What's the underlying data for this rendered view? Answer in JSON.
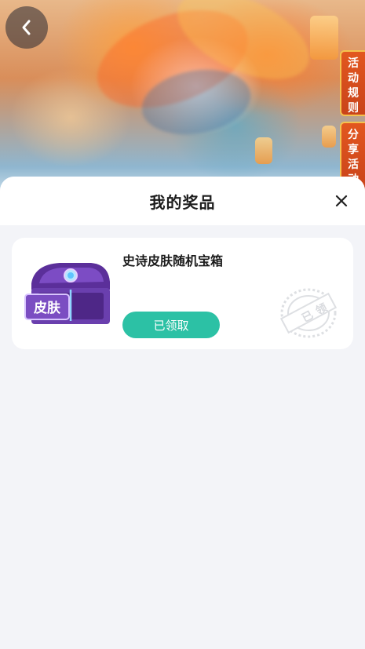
{
  "banner": {
    "tabs": {
      "rules_chars": [
        "活",
        "动",
        "规",
        "则"
      ],
      "share_chars": [
        "分",
        "享",
        "活",
        "动"
      ]
    }
  },
  "sheet": {
    "title": "我的奖品"
  },
  "prizes": [
    {
      "name": "史诗皮肤随机宝箱",
      "chest_label": "皮肤",
      "button_label": "已领取",
      "stamp_text": "已领"
    }
  ],
  "colors": {
    "accent": "#2cc1a5",
    "tab": "#e2571f",
    "chest": "#6a3fae"
  },
  "icons": [
    "chevron-left-icon",
    "close-icon"
  ]
}
